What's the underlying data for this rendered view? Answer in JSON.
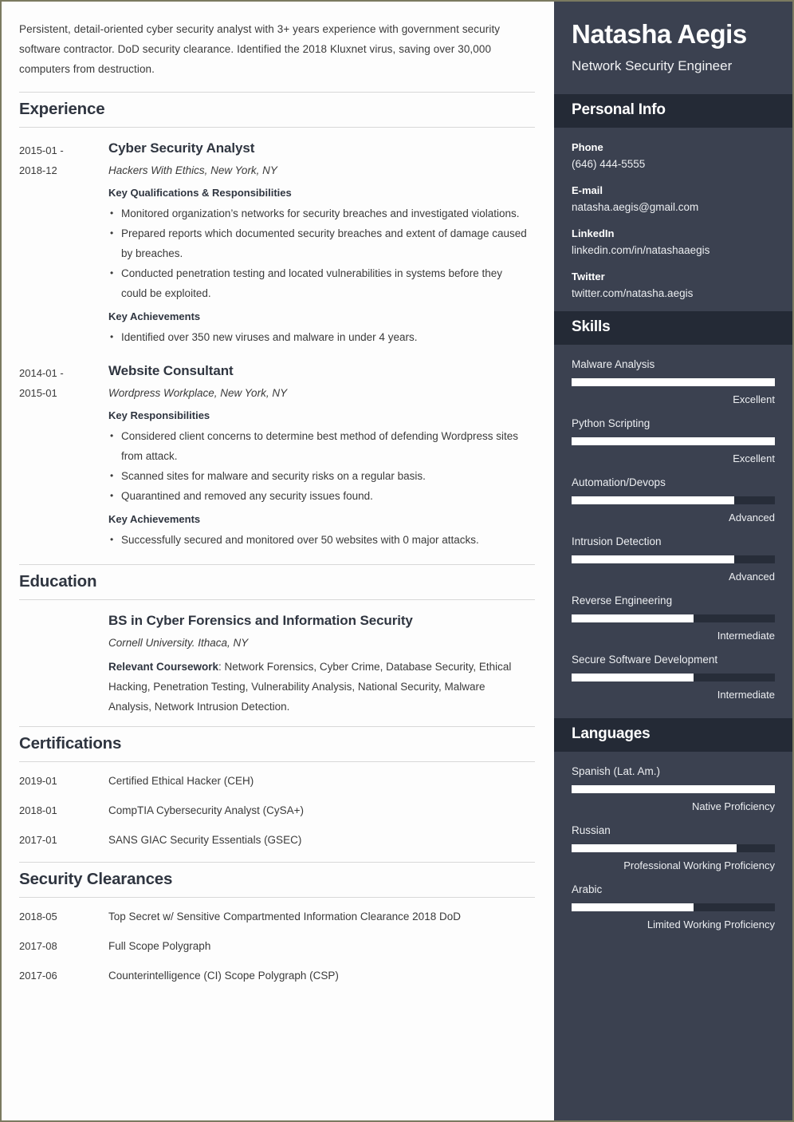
{
  "colors": {
    "page_border": "#7b7a60",
    "sidebar_bg": "#3b4150",
    "sidebar_header_bg": "#242a36",
    "bar_fill": "#ffffff",
    "bar_track": "#272d39",
    "heading_text": "#2f3540"
  },
  "main": {
    "summary": "Persistent, detail-oriented cyber security analyst with 3+ years experience with government security software contractor. DoD security clearance. Identified the 2018 Kluxnet virus, saving over 30,000 computers from destruction.",
    "sections": {
      "experience": {
        "title": "Experience",
        "entries": [
          {
            "date": "2015-01 - 2018-12",
            "title": "Cyber Security Analyst",
            "subtitle": "Hackers With Ethics, New York, NY",
            "groups": [
              {
                "heading": "Key Qualifications & Responsibilities",
                "bullets": [
                  "Monitored organization’s networks for security breaches and investigated violations.",
                  "Prepared reports which documented security breaches and extent of damage caused by breaches.",
                  "Conducted penetration testing and located vulnerabilities in systems before they could be exploited."
                ]
              },
              {
                "heading": "Key Achievements",
                "bullets": [
                  "Identified over 350 new viruses and malware in under 4 years."
                ]
              }
            ]
          },
          {
            "date": "2014-01 - 2015-01",
            "title": "Website Consultant",
            "subtitle": "Wordpress Workplace, New York, NY",
            "groups": [
              {
                "heading": "Key Responsibilities",
                "bullets": [
                  "Considered client concerns to determine best method of defending Wordpress sites from attack.",
                  "Scanned sites for malware and security risks on a regular basis.",
                  "Quarantined and removed any security issues found."
                ]
              },
              {
                "heading": "Key Achievements",
                "bullets": [
                  "Successfully secured and monitored over 50 websites with 0 major attacks."
                ]
              }
            ]
          }
        ]
      },
      "education": {
        "title": "Education",
        "date": "",
        "degree": "BS in Cyber Forensics and Information Security",
        "school": "Cornell University. Ithaca, NY",
        "coursework_label": "Relevant Coursework",
        "coursework_value": ": Network Forensics, Cyber Crime, Database Security, Ethical Hacking, Penetration Testing, Vulnerability Analysis, National Security, Malware Analysis, Network Intrusion Detection."
      },
      "certifications": {
        "title": "Certifications",
        "items": [
          {
            "date": "2019-01",
            "text": "Certified Ethical Hacker (CEH)"
          },
          {
            "date": "2018-01",
            "text": "CompTIA Cybersecurity Analyst (CySA+)"
          },
          {
            "date": "2017-01",
            "text": "SANS GIAC Security Essentials (GSEC)"
          }
        ]
      },
      "clearances": {
        "title": "Security Clearances",
        "items": [
          {
            "date": "2018-05",
            "text": "Top Secret w/ Sensitive Compartmented Information Clearance 2018 DoD"
          },
          {
            "date": "2017-08",
            "text": "Full Scope Polygraph"
          },
          {
            "date": "2017-06",
            "text": "Counterintelligence (CI) Scope Polygraph (CSP)"
          }
        ]
      }
    }
  },
  "sidebar": {
    "name": "Natasha Aegis",
    "job_title": "Network Security Engineer",
    "personal_info": {
      "title": "Personal Info",
      "fields": [
        {
          "label": "Phone",
          "value": "(646) 444-5555"
        },
        {
          "label": "E-mail",
          "value": "natasha.aegis@gmail.com"
        },
        {
          "label": "LinkedIn",
          "value": "linkedin.com/in/natashaaegis"
        },
        {
          "label": "Twitter",
          "value": "twitter.com/natasha.aegis"
        }
      ]
    },
    "skills": {
      "title": "Skills",
      "items": [
        {
          "name": "Malware Analysis",
          "level": "Excellent",
          "percent": 100
        },
        {
          "name": "Python Scripting",
          "level": "Excellent",
          "percent": 100
        },
        {
          "name": "Automation/Devops",
          "level": "Advanced",
          "percent": 80
        },
        {
          "name": "Intrusion Detection",
          "level": "Advanced",
          "percent": 80
        },
        {
          "name": "Reverse Engineering",
          "level": "Intermediate",
          "percent": 60
        },
        {
          "name": "Secure Software Development",
          "level": "Intermediate",
          "percent": 60
        }
      ]
    },
    "languages": {
      "title": "Languages",
      "items": [
        {
          "name": "Spanish (Lat. Am.)",
          "level": "Native Proficiency",
          "percent": 100
        },
        {
          "name": "Russian",
          "level": "Professional Working Proficiency",
          "percent": 81
        },
        {
          "name": "Arabic",
          "level": "Limited Working Proficiency",
          "percent": 60
        }
      ]
    }
  }
}
